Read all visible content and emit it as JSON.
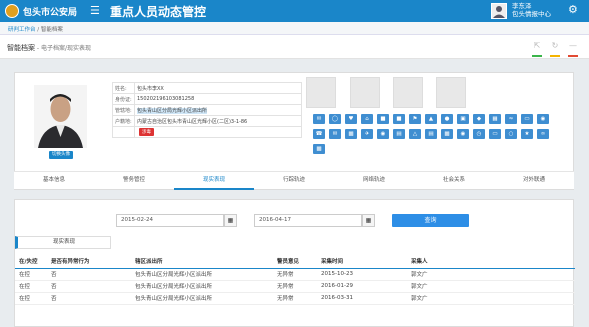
{
  "header": {
    "brand": "包头市公安局",
    "menu_icon": "menu-icon",
    "title": "重点人员动态管控",
    "user_name": "李东泽",
    "user_org": "包头情报中心",
    "settings_icon": "gear-icon",
    "accent": "#1a86c9"
  },
  "breadcrumb": {
    "home": "研判工作台",
    "sep": "/",
    "current": "智能档案"
  },
  "page": {
    "title": "智能档案",
    "subtitle": " - 电子档案/现实表现",
    "controls": [
      "expand-icon",
      "refresh-icon",
      "minimize-icon"
    ]
  },
  "profile": {
    "photo_button": "切换头像",
    "fields": [
      {
        "key": "姓名:",
        "value": "包头市李XX"
      },
      {
        "key": "身份证:",
        "value": "150202196103081258"
      },
      {
        "key": "管辖地:",
        "value": "包头青山区分局光辉小区派出所"
      },
      {
        "key": "户籍地:",
        "value": "内蒙古自治区包头市青山区光辉小区(二区)3-1-86"
      }
    ],
    "tag": "涉毒"
  },
  "tabs": [
    "基本信息",
    "警务管控",
    "现实表现",
    "行踪轨迹",
    "网络轨迹",
    "社会关系",
    "对外联通"
  ],
  "active_tab": 2,
  "search": {
    "start_date": "2015-02-24",
    "end_date": "2016-04-17",
    "query_button": "查询",
    "calendar_icon": "calendar-icon"
  },
  "subtab": "现实表现",
  "table": {
    "headers": [
      "在/失控",
      "是否有异常行为",
      "辖区派出所",
      "警员意见",
      "采集时间",
      "采集人"
    ],
    "rows": [
      [
        "在控",
        "否",
        "包头青山区分局光辉小区派出所",
        "无异常",
        "2015-10-23",
        "郭文广"
      ],
      [
        "在控",
        "否",
        "包头青山区分局光辉小区派出所",
        "无异常",
        "2016-01-29",
        "郭文广"
      ],
      [
        "在控",
        "否",
        "包头青山区分局光辉小区派出所",
        "无异常",
        "2016-03-31",
        "郭文广"
      ]
    ]
  }
}
